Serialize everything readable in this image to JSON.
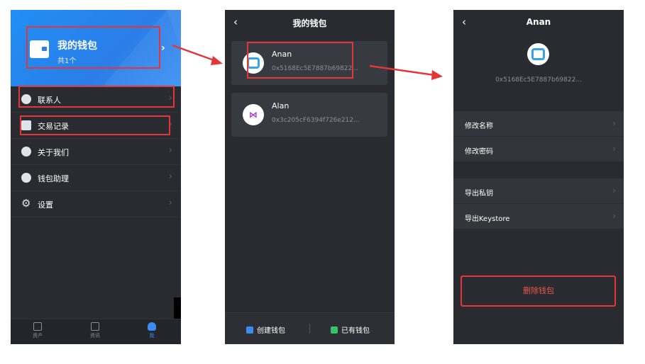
{
  "phone1": {
    "header": {
      "title": "我的钱包",
      "subtitle": "共1个"
    },
    "menu": [
      {
        "label": "联系人"
      },
      {
        "label": "交易记录"
      },
      {
        "label": "关于我们"
      },
      {
        "label": "钱包助理"
      },
      {
        "label": "设置"
      }
    ],
    "tabs": [
      {
        "label": "资产"
      },
      {
        "label": "资讯"
      },
      {
        "label": "我"
      }
    ]
  },
  "phone2": {
    "title": "我的钱包",
    "wallets": [
      {
        "name": "Anan",
        "address": "0x5168Ec5E7887b69822..."
      },
      {
        "name": "Alan",
        "address": "0x3c205cF6394f726e212..."
      }
    ],
    "bottom": {
      "create_label": "创建钱包",
      "import_label": "已有钱包"
    }
  },
  "phone3": {
    "title": "Anan",
    "address": "0x5168Ec5E7887b69822...",
    "list1": [
      {
        "label": "修改名称"
      },
      {
        "label": "修改密码"
      }
    ],
    "list2": [
      {
        "label": "导出私钥"
      },
      {
        "label": "导出Keystore"
      }
    ],
    "delete_label": "删除钱包"
  },
  "colors": {
    "bg": "#2a2b31",
    "header_blue": "#2b7ee8",
    "annotation_red": "#e43636",
    "delete_red": "#e85a4a"
  }
}
